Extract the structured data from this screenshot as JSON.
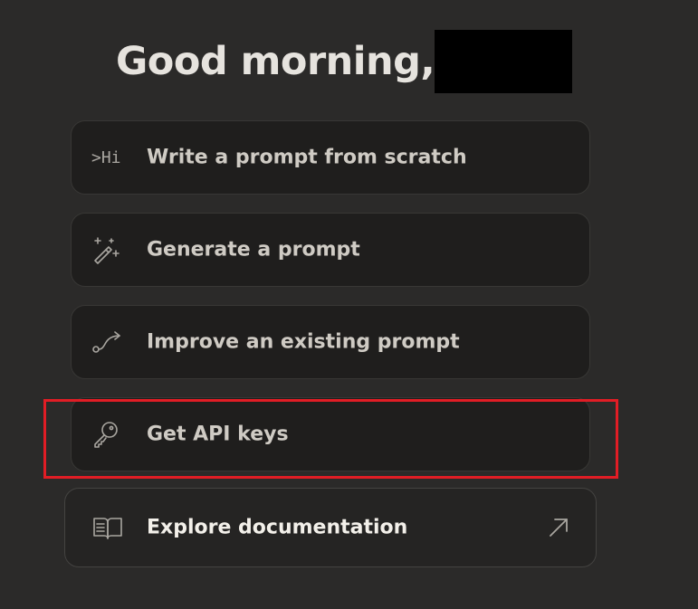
{
  "greeting": "Good morning,",
  "cards": [
    {
      "icon_text": ">Hi",
      "icon": "prompt-terminal-icon",
      "label": "Write a prompt from scratch"
    },
    {
      "icon": "magic-wand-icon",
      "label": "Generate a prompt"
    },
    {
      "icon": "curve-arrow-icon",
      "label": "Improve an existing prompt"
    },
    {
      "icon": "key-icon",
      "label": "Get API keys"
    },
    {
      "icon": "open-book-icon",
      "label": "Explore documentation",
      "trailing_icon": "external-arrow-icon"
    }
  ],
  "colors": {
    "background": "#2b2a29",
    "card": "#1f1e1d",
    "highlight": "#e11d25"
  }
}
